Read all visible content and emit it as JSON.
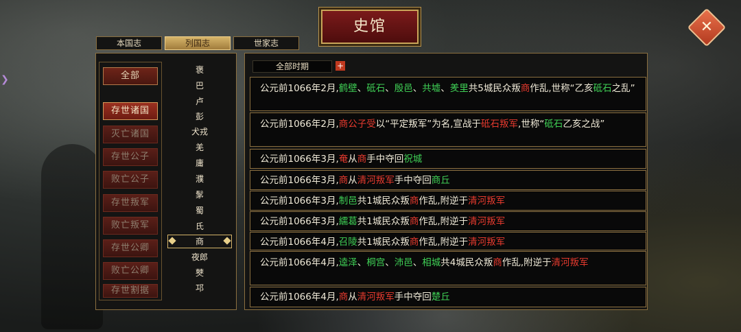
{
  "title": "史馆",
  "close_icon": "close-x-icon",
  "tabs": [
    "本国志",
    "列国志",
    "世家志"
  ],
  "active_tab": 1,
  "categories": [
    "全部",
    "存世诸国",
    "灭亡诸国",
    "存世公子",
    "败亡公子",
    "存世叛军",
    "败亡叛军",
    "存世公卿",
    "败亡公卿",
    "存世割据"
  ],
  "active_category": 1,
  "clans": [
    "褒",
    "巴",
    "卢",
    "彭",
    "犬戎",
    "羌",
    "庸",
    "濮",
    "髳",
    "蜀",
    "氏",
    "商",
    "夜郎",
    "僰",
    "邛"
  ],
  "selected_clan": 11,
  "filter": {
    "label": "全部时期",
    "plus": "+"
  },
  "events": [
    {
      "segments": [
        {
          "t": "公元前1066年2月,",
          "c": "w"
        },
        {
          "t": "鹤壁",
          "c": "g"
        },
        {
          "t": "、",
          "c": "w"
        },
        {
          "t": "砥石",
          "c": "g"
        },
        {
          "t": "、",
          "c": "w"
        },
        {
          "t": "殷邑",
          "c": "g"
        },
        {
          "t": "、",
          "c": "w"
        },
        {
          "t": "共墟",
          "c": "g"
        },
        {
          "t": "、",
          "c": "w"
        },
        {
          "t": "羑里",
          "c": "g"
        },
        {
          "t": "共5城民众叛",
          "c": "w"
        },
        {
          "t": "商",
          "c": "r"
        },
        {
          "t": "作乱,世称“乙亥",
          "c": "w"
        },
        {
          "t": "砥石",
          "c": "g"
        },
        {
          "t": "之乱”",
          "c": "w"
        }
      ]
    },
    {
      "segments": [
        {
          "t": "公元前1066年2月,",
          "c": "w"
        },
        {
          "t": "商公子受",
          "c": "r"
        },
        {
          "t": "以“平定叛军”为名,宣战于",
          "c": "w"
        },
        {
          "t": "砥石叛军",
          "c": "r"
        },
        {
          "t": ",世称“",
          "c": "w"
        },
        {
          "t": "砥石",
          "c": "g"
        },
        {
          "t": "乙亥之战”",
          "c": "w"
        }
      ]
    },
    {
      "segments": [
        {
          "t": "公元前1066年3月,",
          "c": "w"
        },
        {
          "t": "奄",
          "c": "r"
        },
        {
          "t": "从",
          "c": "w"
        },
        {
          "t": "商",
          "c": "r"
        },
        {
          "t": "手中夺回",
          "c": "w"
        },
        {
          "t": "祝城",
          "c": "g"
        }
      ]
    },
    {
      "segments": [
        {
          "t": "公元前1066年3月,",
          "c": "w"
        },
        {
          "t": "商",
          "c": "r"
        },
        {
          "t": "从",
          "c": "w"
        },
        {
          "t": "清河叛军",
          "c": "r"
        },
        {
          "t": "手中夺回",
          "c": "w"
        },
        {
          "t": "商丘",
          "c": "g"
        }
      ]
    },
    {
      "segments": [
        {
          "t": "公元前1066年3月,",
          "c": "w"
        },
        {
          "t": "制邑",
          "c": "g"
        },
        {
          "t": "共1城民众叛",
          "c": "w"
        },
        {
          "t": "商",
          "c": "r"
        },
        {
          "t": "作乱,附逆于",
          "c": "w"
        },
        {
          "t": "清河叛军",
          "c": "r"
        }
      ]
    },
    {
      "segments": [
        {
          "t": "公元前1066年3月,",
          "c": "w"
        },
        {
          "t": "繻葛",
          "c": "g"
        },
        {
          "t": "共1城民众叛",
          "c": "w"
        },
        {
          "t": "商",
          "c": "r"
        },
        {
          "t": "作乱,附逆于",
          "c": "w"
        },
        {
          "t": "清河叛军",
          "c": "r"
        }
      ]
    },
    {
      "segments": [
        {
          "t": "公元前1066年4月,",
          "c": "w"
        },
        {
          "t": "召陵",
          "c": "g"
        },
        {
          "t": "共1城民众叛",
          "c": "w"
        },
        {
          "t": "商",
          "c": "r"
        },
        {
          "t": "作乱,附逆于",
          "c": "w"
        },
        {
          "t": "清河叛军",
          "c": "r"
        }
      ]
    },
    {
      "segments": [
        {
          "t": "公元前1066年4月,",
          "c": "w"
        },
        {
          "t": "逵泽",
          "c": "g"
        },
        {
          "t": "、",
          "c": "w"
        },
        {
          "t": "桐宫",
          "c": "g"
        },
        {
          "t": "、",
          "c": "w"
        },
        {
          "t": "沛邑",
          "c": "g"
        },
        {
          "t": "、",
          "c": "w"
        },
        {
          "t": "相城",
          "c": "g"
        },
        {
          "t": "共4城民众叛",
          "c": "w"
        },
        {
          "t": "商",
          "c": "r"
        },
        {
          "t": "作乱,附逆于",
          "c": "w"
        },
        {
          "t": "清河叛军",
          "c": "r"
        }
      ]
    },
    {
      "segments": [
        {
          "t": "公元前1066年4月,",
          "c": "w"
        },
        {
          "t": "商",
          "c": "r"
        },
        {
          "t": "从",
          "c": "w"
        },
        {
          "t": "清河叛军",
          "c": "r"
        },
        {
          "t": "手中夺回",
          "c": "w"
        },
        {
          "t": "楚丘",
          "c": "g"
        }
      ]
    }
  ]
}
